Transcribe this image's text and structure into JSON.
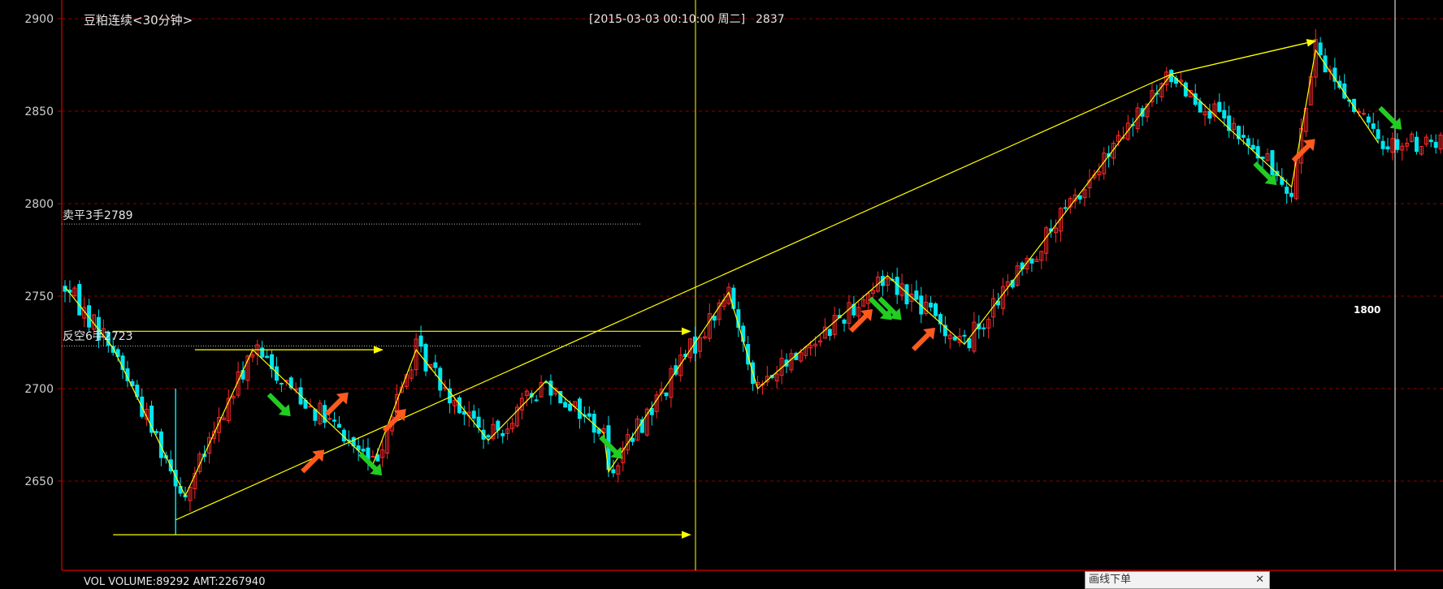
{
  "header": {
    "symbol_title": "豆粕连续<30分钟>",
    "cursor_info": "[2015-03-03  00:10:00 周二]",
    "cursor_price": "2837"
  },
  "volume_panel": {
    "label": "VOL  VOLUME:89292 AMT:2267940"
  },
  "popup": {
    "label": "画线下单",
    "close_glyph": "✕"
  },
  "orders": {
    "sell_close": {
      "label": "卖平3手2789",
      "price": 2789
    },
    "reverse_short": {
      "label": "反空6手2723",
      "price": 2723
    }
  },
  "right_marker": {
    "label": "1800",
    "price": 2741
  },
  "colors": {
    "background": "#000000",
    "up_candle": "#ff2a2a",
    "down_candle": "#00e5ee",
    "trend_line": "#ffff00",
    "frame": "#b40000",
    "grid": "#8b0000",
    "arrow_up": "#ff5a1e",
    "arrow_down": "#22cc22"
  },
  "chart_data": {
    "type": "candlestick",
    "title": "豆粕连续<30分钟>",
    "ylim": [
      2600,
      2905
    ],
    "y_ticks": [
      2650,
      2700,
      2750,
      2800,
      2850,
      2900
    ],
    "grid": true,
    "bars": 290,
    "trend_zigzag": [
      {
        "i": 0,
        "p": 2755
      },
      {
        "i": 10,
        "p": 2722
      },
      {
        "i": 25,
        "p": 2642
      },
      {
        "i": 39,
        "p": 2721
      },
      {
        "i": 64,
        "p": 2659
      },
      {
        "i": 73,
        "p": 2721
      },
      {
        "i": 88,
        "p": 2672
      },
      {
        "i": 100,
        "p": 2704
      },
      {
        "i": 112,
        "p": 2676
      },
      {
        "i": 113,
        "p": 2655
      },
      {
        "i": 138,
        "p": 2752
      },
      {
        "i": 144,
        "p": 2700
      },
      {
        "i": 171,
        "p": 2761
      },
      {
        "i": 187,
        "p": 2724
      },
      {
        "i": 230,
        "p": 2870
      },
      {
        "i": 255,
        "p": 2809
      },
      {
        "i": 260,
        "p": 2883
      },
      {
        "i": 273,
        "p": 2833
      }
    ],
    "long_trend_lines": [
      {
        "from": {
          "i": 23,
          "p": 2629
        },
        "to": {
          "i": 230,
          "p": 2870
        }
      },
      {
        "from": {
          "i": 230,
          "p": 2870
        },
        "to": {
          "i": 260,
          "p": 2888
        }
      }
    ],
    "horizontal_rays": [
      {
        "from_i": 10,
        "to_i": 130,
        "p": 2621
      },
      {
        "from_i": 10,
        "to_i": 130,
        "p": 2731
      },
      {
        "from_i": 27,
        "to_i": 66,
        "p": 2721
      }
    ],
    "signals": [
      {
        "i": 45,
        "p": 2690,
        "dir": "down"
      },
      {
        "i": 52,
        "p": 2662,
        "dir": "up"
      },
      {
        "i": 57,
        "p": 2693,
        "dir": "up"
      },
      {
        "i": 64,
        "p": 2658,
        "dir": "down"
      },
      {
        "i": 69,
        "p": 2684,
        "dir": "up"
      },
      {
        "i": 114,
        "p": 2667,
        "dir": "down"
      },
      {
        "i": 166,
        "p": 2738,
        "dir": "up"
      },
      {
        "i": 170,
        "p": 2742,
        "dir": "down"
      },
      {
        "i": 172,
        "p": 2742,
        "dir": "down"
      },
      {
        "i": 179,
        "p": 2728,
        "dir": "up"
      },
      {
        "i": 250,
        "p": 2815,
        "dir": "down"
      },
      {
        "i": 258,
        "p": 2830,
        "dir": "up"
      },
      {
        "i": 276,
        "p": 2845,
        "dir": "down"
      }
    ]
  }
}
